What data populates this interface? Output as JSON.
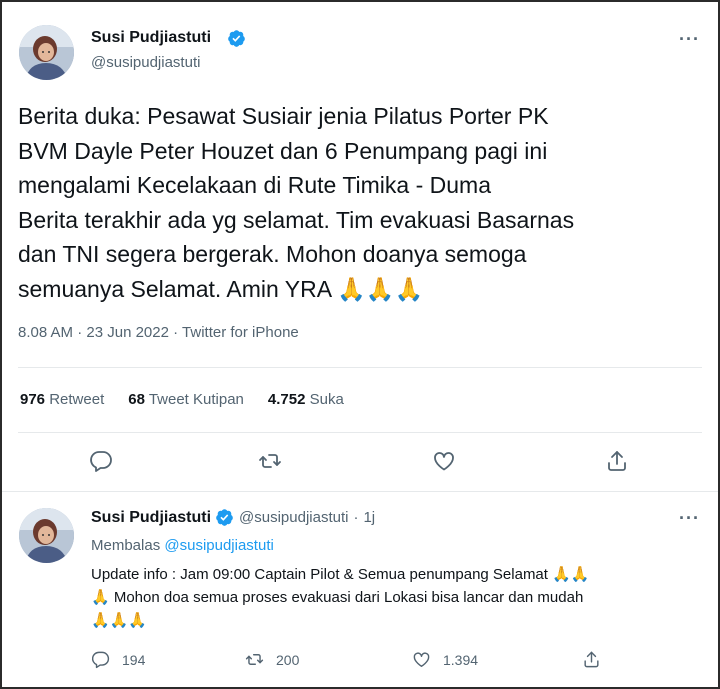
{
  "tweet": {
    "author_name": "Susi Pudjiastuti",
    "author_handle": "@susipudjiastuti",
    "text": "Berita duka: Pesawat Susiair jenia Pilatus Porter PK\nBVM Dayle Peter Houzet dan 6 Penumpang pagi ini\nmengalami Kecelakaan di Rute Timika - Duma\nBerita terakhir ada yg selamat. Tim evakuasi  Basarnas\ndan TNI segera bergerak. Mohon doanya semoga\nsemuanya Selamat. Amin YRA 🙏🙏🙏",
    "time": "8.08 AM",
    "date": "23 Jun 2022",
    "source": "Twitter for iPhone",
    "separator": "·",
    "more_label": "···",
    "stats": {
      "retweets_count": "976",
      "retweets_label": "Retweet",
      "quotes_count": "68",
      "quotes_label": "Tweet Kutipan",
      "likes_count": "4.752",
      "likes_label": "Suka"
    },
    "actions": [
      "reply-icon",
      "retweet-icon",
      "like-icon",
      "share-icon"
    ]
  },
  "reply": {
    "author_name": "Susi Pudjiastuti",
    "author_handle": "@susipudjiastuti",
    "age": "1j",
    "separator": "·",
    "more_label": "···",
    "replying_prefix": "Membalas",
    "replying_to": "@susipudjiastuti",
    "text": "Update info : Jam 09:00 Captain Pilot & Semua penumpang Selamat 🙏🙏\n🙏 Mohon doa semua proses evakuasi dari Lokasi bisa lancar dan mudah\n🙏🙏🙏",
    "replies": "194",
    "retweets": "200",
    "likes": "1.394"
  },
  "colors": {
    "accent": "#1d9bf0",
    "secondary_text": "#536471",
    "primary_text": "#0f1419",
    "divider": "#e6e9eb"
  }
}
